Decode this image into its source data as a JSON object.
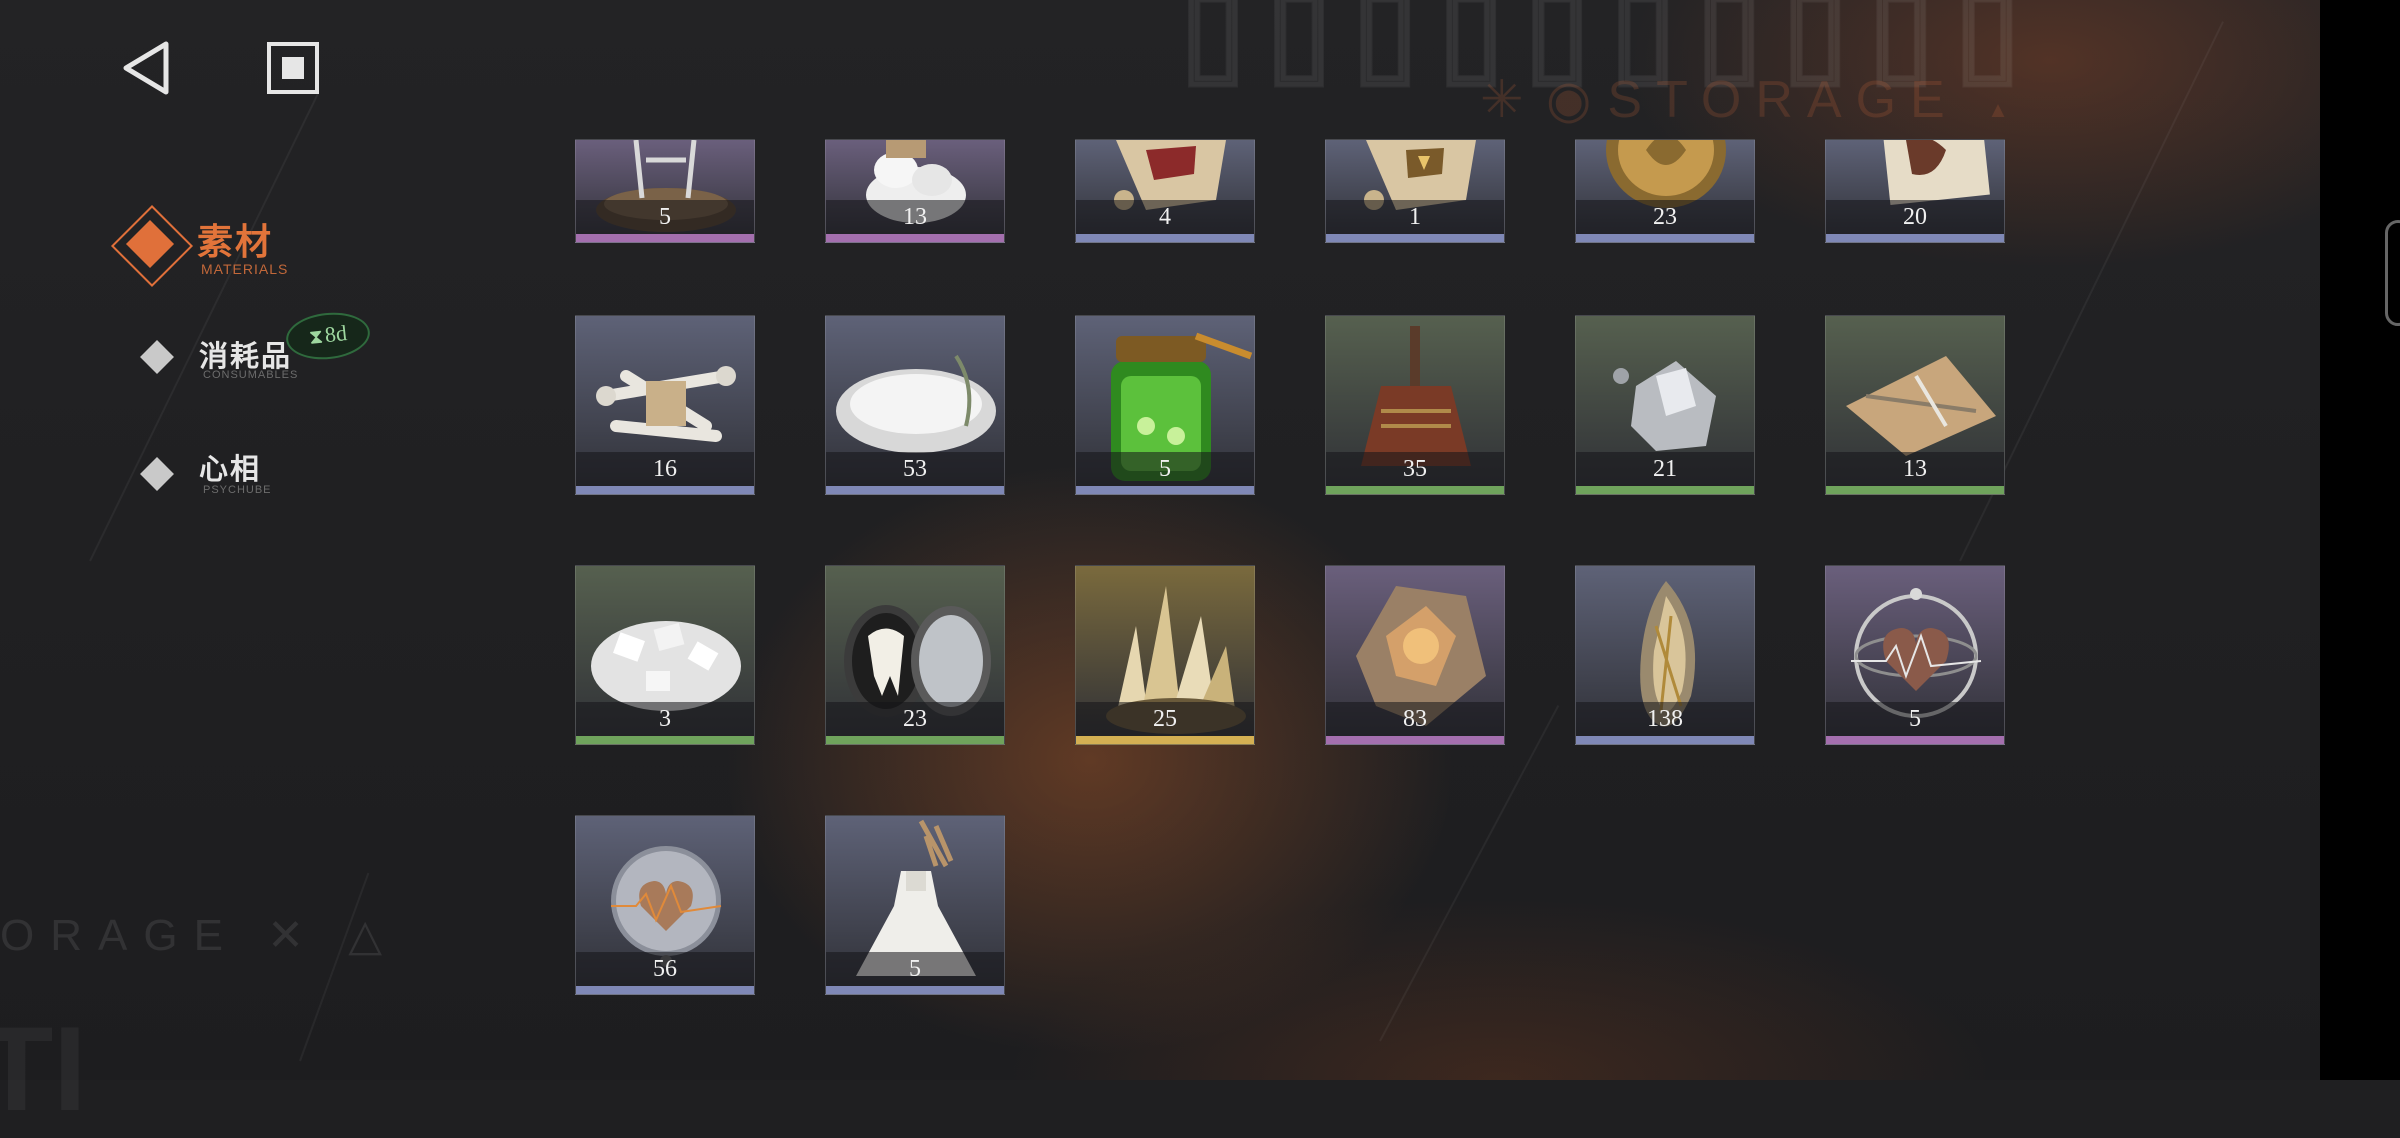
{
  "background": {
    "deco_title": "STORAGE",
    "deco_title_symbols": "✳ ◉",
    "deco_title_tail": "▲",
    "deco_left": "ORAGE ✕ △",
    "deco_left_big": "TI"
  },
  "top_controls": {
    "back_icon": "back-triangle-icon",
    "menu_icon": "stop-square-icon"
  },
  "sidebar": {
    "items": [
      {
        "label": "素材",
        "sub": "MATERIALS",
        "active": true
      },
      {
        "label": "消耗品",
        "sub": "CONSUMABLES",
        "active": false
      },
      {
        "label": "心相",
        "sub": "PSYCHUBE",
        "active": false
      }
    ],
    "timer_badge": {
      "icon": "hourglass-icon",
      "text": "8d"
    }
  },
  "rarity_colors": {
    "green": "#6fa35c",
    "blue": "#7f88b6",
    "purple": "#a46fae",
    "gold": "#d4b053"
  },
  "items": [
    {
      "qty": "5",
      "rarity": "purple",
      "bg": "#6a5f7c",
      "icon": "skeleton-stand-icon"
    },
    {
      "qty": "13",
      "rarity": "purple",
      "bg": "#6a5f7c",
      "icon": "salt-pile-icon"
    },
    {
      "qty": "4",
      "rarity": "blue",
      "bg": "#5e6277",
      "icon": "scroll-seal-red-icon"
    },
    {
      "qty": "1",
      "rarity": "blue",
      "bg": "#5e6277",
      "icon": "scroll-seal-gold-icon"
    },
    {
      "qty": "23",
      "rarity": "blue",
      "bg": "#5e6277",
      "icon": "gold-coin-icon"
    },
    {
      "qty": "20",
      "rarity": "blue",
      "bg": "#5e6277",
      "icon": "letter-card-icon"
    },
    {
      "qty": "16",
      "rarity": "blue",
      "bg": "#5e6277",
      "icon": "bones-bundle-icon"
    },
    {
      "qty": "53",
      "rarity": "blue",
      "bg": "#5e6277",
      "icon": "salt-plate-icon"
    },
    {
      "qty": "5",
      "rarity": "blue",
      "bg": "#5e6277",
      "icon": "honey-jar-icon"
    },
    {
      "qty": "35",
      "rarity": "green",
      "bg": "#56604f",
      "icon": "broom-icon"
    },
    {
      "qty": "21",
      "rarity": "green",
      "bg": "#56604f",
      "icon": "silver-ore-icon"
    },
    {
      "qty": "13",
      "rarity": "green",
      "bg": "#56604f",
      "icon": "paper-sheet-icon"
    },
    {
      "qty": "3",
      "rarity": "green",
      "bg": "#56604f",
      "icon": "rock-salt-icon"
    },
    {
      "qty": "23",
      "rarity": "green",
      "bg": "#56604f",
      "icon": "tooth-locket-icon"
    },
    {
      "qty": "25",
      "rarity": "gold",
      "bg": "#7a6a3d",
      "icon": "crystal-cluster-icon"
    },
    {
      "qty": "83",
      "rarity": "purple",
      "bg": "#6a5f7c",
      "icon": "amber-crystal-icon"
    },
    {
      "qty": "138",
      "rarity": "blue",
      "bg": "#5e6277",
      "icon": "rutile-quartz-icon"
    },
    {
      "qty": "5",
      "rarity": "purple",
      "bg": "#6a5f7c",
      "icon": "heart-gyroscope-icon"
    },
    {
      "qty": "56",
      "rarity": "blue",
      "bg": "#5e6277",
      "icon": "heart-orb-icon"
    },
    {
      "qty": "5",
      "rarity": "blue",
      "bg": "#5e6277",
      "icon": "white-dress-icon"
    }
  ]
}
